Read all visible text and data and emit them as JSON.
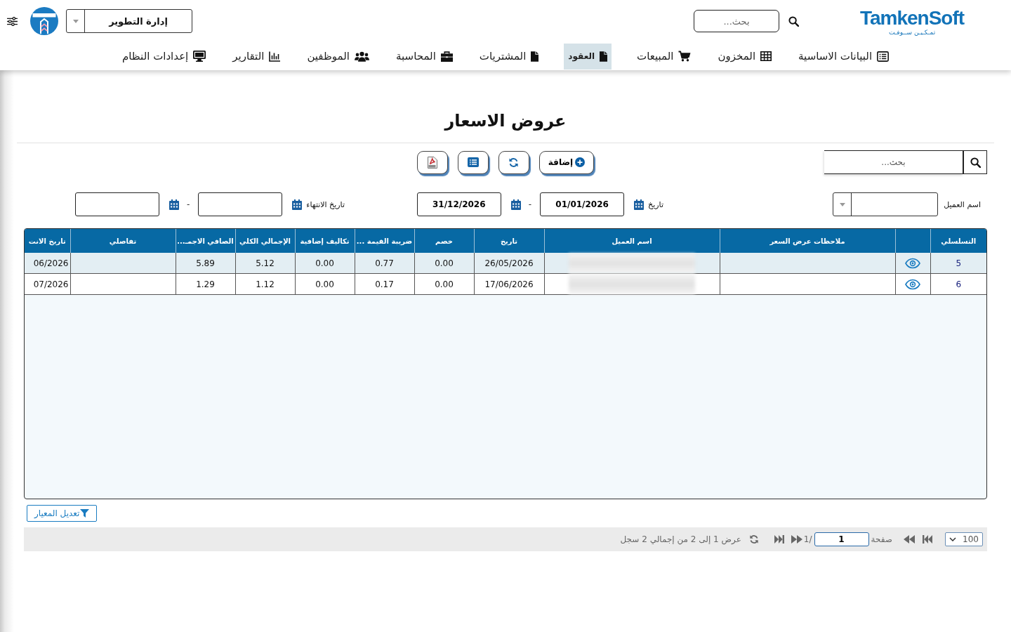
{
  "header": {
    "logo": {
      "text": "TamkenSoft",
      "subtitle": "تمـكـيـن ســوفـت"
    },
    "search": {
      "placeholder": "بحث..."
    },
    "department_select": {
      "value": "إدارة التطوير"
    }
  },
  "nav": [
    {
      "label": "البيانات الاساسية",
      "selected": false
    },
    {
      "label": "المخزون",
      "selected": false
    },
    {
      "label": "المبيعات",
      "selected": false
    },
    {
      "label": "العقود",
      "selected": true
    },
    {
      "label": "المشتريات",
      "selected": false
    },
    {
      "label": "المحاسبة",
      "selected": false
    },
    {
      "label": "الموظفين",
      "selected": false
    },
    {
      "label": "التقارير",
      "selected": false
    },
    {
      "label": "إعدادات النظام",
      "selected": false
    }
  ],
  "page_title": "عروض الاسعار",
  "toolbar": {
    "search": {
      "placeholder": "بحث..."
    },
    "add_button": {
      "label": "إضافة"
    }
  },
  "filters": {
    "customer": {
      "label": "اسم العميل"
    },
    "date": {
      "label": "تاريخ",
      "from": "01/01/2026",
      "separator": "-",
      "to": "31/12/2026"
    },
    "end_date": {
      "label": "تاريخ الانتهاء",
      "separator": "-"
    }
  },
  "table": {
    "columns": [
      "التسلسلي",
      "ملاحظات عرض السعر",
      "اسم العميل",
      "تاريخ",
      "خصم",
      "ضريبة القيمة ...",
      "تكاليف إضافية",
      "الإجمالي الكلي",
      "الصافي الاجمـ...",
      "تفاصلي",
      "تاريخ الانت"
    ],
    "rows": [
      {
        "serial": "5",
        "selected": true,
        "customer_blurred": true,
        "date": "26/05/2026",
        "discount": "0.00",
        "vat": "0.77",
        "extra_costs": "0.00",
        "total": "5.12",
        "net": "5.89",
        "end_date": "06/2026"
      },
      {
        "serial": "6",
        "selected": false,
        "customer_blurred": true,
        "date": "17/06/2026",
        "discount": "0.00",
        "vat": "0.17",
        "extra_costs": "0.00",
        "total": "1.12",
        "net": "1.29",
        "end_date": "07/2026"
      }
    ]
  },
  "filter_button": {
    "label": "تعديل المعيار"
  },
  "pager": {
    "page_size": "100",
    "page_label": "صفحة",
    "page": "1",
    "page_count": "1/",
    "summary": "عرض 1 إلى 2 من إجمالي 2 سجل"
  }
}
